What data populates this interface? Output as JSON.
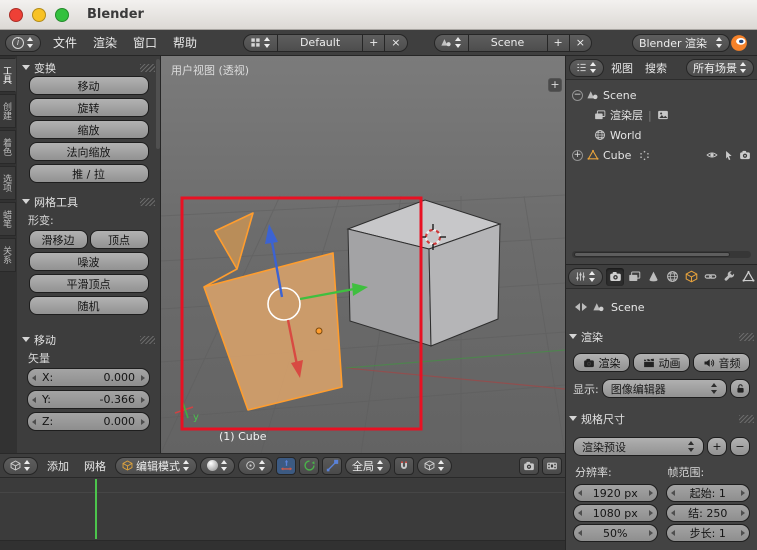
{
  "window": {
    "title": "Blender"
  },
  "topbar": {
    "menus": [
      "文件",
      "渲染",
      "窗口",
      "帮助"
    ],
    "layout": {
      "value": "Default"
    },
    "scene": {
      "value": "Scene"
    },
    "engine": {
      "value": "Blender 渲染"
    }
  },
  "tool_shelf": {
    "tabs": [
      "工具",
      "创建",
      "着色",
      "选项",
      "蜡笔",
      "关系"
    ],
    "transform": {
      "title": "变换",
      "buttons": [
        "移动",
        "旋转",
        "缩放",
        "法向缩放",
        "推 / 拉"
      ]
    },
    "mesh_tools": {
      "title": "网格工具",
      "deform_label": "形变:",
      "pair_buttons": [
        "滑移边",
        "顶点"
      ],
      "buttons": [
        "噪波",
        "平滑顶点",
        "随机"
      ]
    },
    "operator": {
      "title": "移动",
      "vector_label": "矢量",
      "fields": [
        {
          "label": "X:",
          "value": "0.000"
        },
        {
          "label": "Y:",
          "value": "-0.366"
        },
        {
          "label": "Z:",
          "value": "0.000"
        }
      ]
    }
  },
  "viewport": {
    "view_label": "用户视图 (透视)",
    "object_label": "(1) Cube",
    "axis_label": "y",
    "plus_label": "+",
    "header": {
      "menus": [
        "添加",
        "网格"
      ],
      "mode": "编辑模式",
      "orientation": "全局"
    }
  },
  "outliner": {
    "menus": [
      "视图",
      "搜索"
    ],
    "display_filter": "所有场景",
    "items": [
      {
        "label": "Scene"
      },
      {
        "label": "渲染层"
      },
      {
        "label": "World"
      },
      {
        "label": "Cube"
      }
    ]
  },
  "properties": {
    "breadcrumb": "Scene",
    "render": {
      "title": "渲染",
      "buttons": [
        "渲染",
        "动画",
        "音频"
      ],
      "display_label": "显示:",
      "display_value": "图像编辑器"
    },
    "dimensions": {
      "title": "规格尺寸",
      "preset": "渲染预设",
      "plus": "+",
      "minus": "−",
      "resolution_label": "分辨率:",
      "frame_label": "帧范围:",
      "res_fields": [
        "1920 px",
        "1080 px",
        "50%"
      ],
      "frame_fields": [
        "起始: 1",
        "结: 250",
        "步长: 1"
      ]
    }
  },
  "colors": {
    "selection_orange": "#ff9d2e",
    "annotation_red": "#e81123",
    "playhead_green": "#4cc44c"
  }
}
